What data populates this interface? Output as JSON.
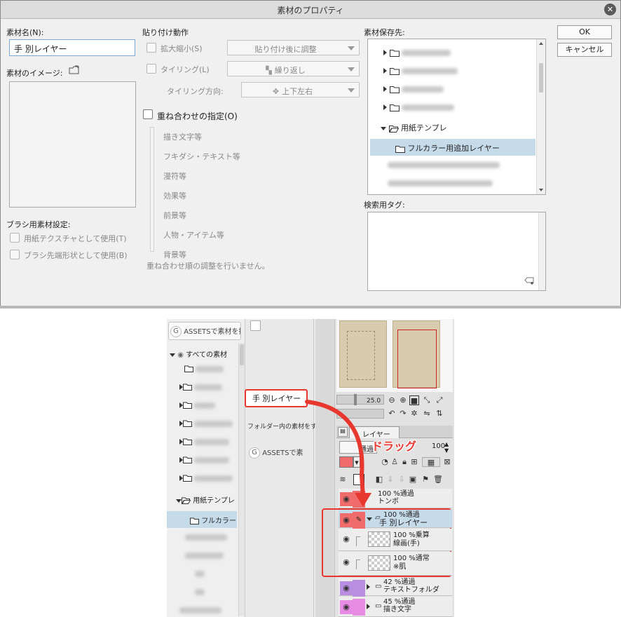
{
  "dialog": {
    "title": "素材のプロパティ",
    "material_name_label": "素材名(N):",
    "material_name_value": "手 別レイヤー",
    "image_label": "素材のイメージ:",
    "brush_settings_label": "ブラシ用素材設定:",
    "brush_option1": "用紙テクスチャとして使用(T)",
    "brush_option2": "ブラシ先端形状として使用(B)",
    "paste_label": "貼り付け動作",
    "scale_label": "拡大縮小(S)",
    "scale_value": "貼り付け後に調整",
    "tiling_label": "タイリング(L)",
    "tiling_value": "繰り返し",
    "tiling_dir_label": "タイリング方向:",
    "tiling_dir_value": "上下左右",
    "overlap_label": "重ね合わせの指定(O)",
    "overlap_items": [
      "描き文字等",
      "フキダシ・テキスト等",
      "漫符等",
      "効果等",
      "前景等",
      "人物・アイテム等",
      "背景等"
    ],
    "overlap_note": "重ね合わせ順の調整を行いません。",
    "save_dest_label": "素材保存先:",
    "tree_open_folder": "用紙テンプレ",
    "tree_selected": "フルカラー用追加レイヤー",
    "tags_label": "検索用タグ:",
    "ok_label": "OK",
    "cancel_label": "キャンセル"
  },
  "shot": {
    "assets_button": "ASSETSで素材を探",
    "assets_button2": "ASSETSで素",
    "all_materials": "すべての素材",
    "folder_open": "用紙テンプレ",
    "folder_selected": "フルカラー",
    "drag_item": "手 別レイヤー",
    "folder_hint": "フォルダー内の素材をす",
    "zoom_value": "25.0",
    "layer_tab": "レイヤー",
    "blend_mode": "通過",
    "opacity_value": "100",
    "drag_label": "ドラッグ",
    "layers": [
      {
        "mode": "100 %通過",
        "name": "トンボ"
      },
      {
        "mode": "100 %通過",
        "name": "手 別レイヤー"
      },
      {
        "mode": "100 %乗算",
        "name": "線画(手)"
      },
      {
        "mode": "100 %通常",
        "name": "※肌"
      },
      {
        "mode": "42 %通過",
        "name": "テキストフォルダ"
      },
      {
        "mode": "45 %通過",
        "name": "描き文字"
      }
    ]
  },
  "colors": {
    "highlight_red": "#e8372e",
    "selection_blue": "#c6dbea",
    "layer_red": "#f06b6b",
    "layer_purple": "#b98ee0",
    "layer_pink": "#e88be3"
  },
  "icons": [
    "close-icon",
    "image-folder-icon",
    "folder-icon",
    "tiling-icon",
    "direction-icon",
    "tag-add-icon",
    "eye-icon",
    "pen-icon",
    "zoom-in-icon",
    "zoom-out-icon",
    "rotate-icon",
    "drag-arrow-icon"
  ]
}
